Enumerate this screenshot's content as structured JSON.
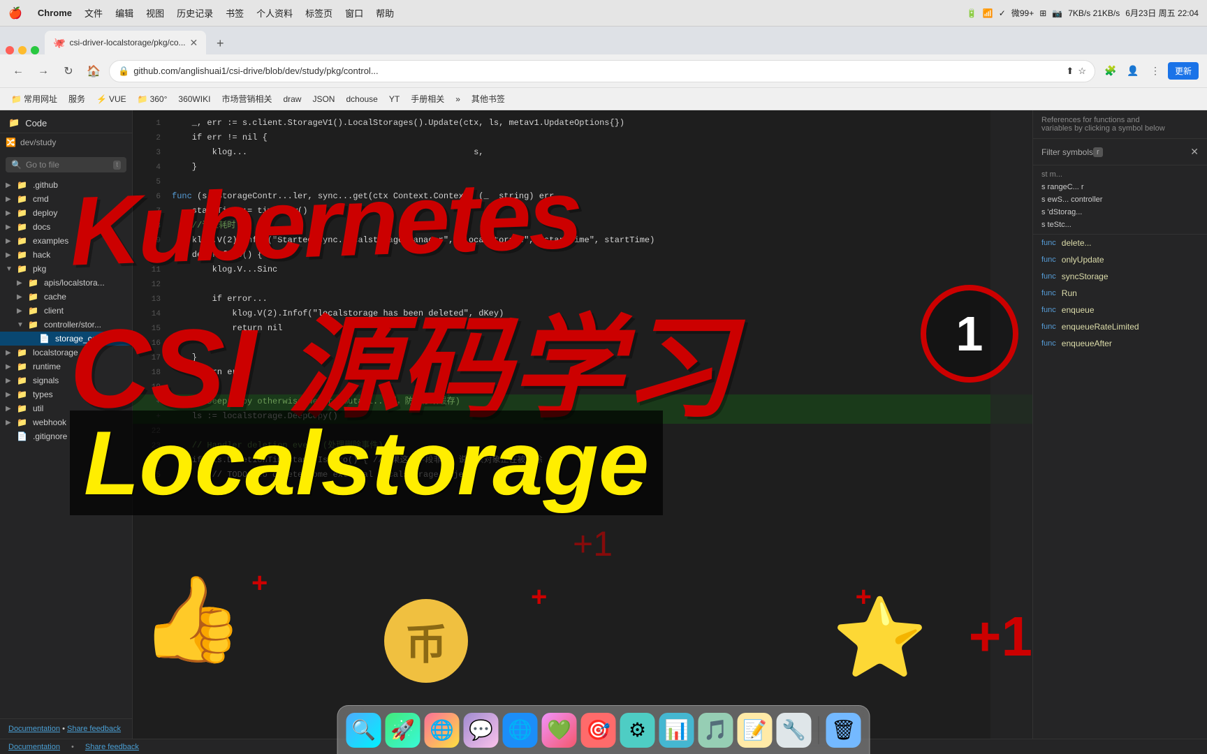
{
  "menubar": {
    "apple": "🍎",
    "items": [
      "Chrome",
      "文件",
      "编辑",
      "视图",
      "历史记录",
      "书签",
      "个人资料",
      "标签页",
      "窗口",
      "帮助"
    ],
    "right_items": [
      "🔋2",
      "🔋",
      "WiFi",
      "✓",
      "WeChat 99+",
      "⚙",
      "📷",
      "7KB/s 21KB/s",
      "☀",
      "6月23日 周五 22:04"
    ]
  },
  "browser": {
    "tab": {
      "favicon": "🐙",
      "title": "csi-driver-localstorage/pkg/co...",
      "url": "github.com/anglishuai1/csi-drive/blob/dev/study/pkg/control..."
    },
    "address_bar": {
      "back": "←",
      "forward": "→",
      "refresh": "↻",
      "url": "github.com/anglishuai1/csi-drive/blob/dev/study/pkg/control..."
    }
  },
  "bookmarks": [
    "常用网址",
    "服务",
    "VUE",
    "360°",
    "360WIKI",
    "市场营销相关",
    "draw",
    "JSON",
    "dchouse",
    "YT",
    "手册相关",
    "其他书签"
  ],
  "sidebar": {
    "header_icon": "📁",
    "header_title": "Code",
    "branch": "dev/study",
    "search_placeholder": "Go to file",
    "search_shortcut": "t",
    "tree": [
      {
        "indent": 0,
        "type": "folder",
        "expanded": false,
        "name": ".github"
      },
      {
        "indent": 0,
        "type": "folder",
        "expanded": false,
        "name": "cmd"
      },
      {
        "indent": 0,
        "type": "folder",
        "expanded": false,
        "name": "deploy"
      },
      {
        "indent": 0,
        "type": "folder",
        "expanded": false,
        "name": "docs"
      },
      {
        "indent": 0,
        "type": "folder",
        "expanded": false,
        "name": "examples"
      },
      {
        "indent": 0,
        "type": "folder",
        "expanded": false,
        "name": "hack"
      },
      {
        "indent": 0,
        "type": "folder",
        "expanded": true,
        "name": "pkg"
      },
      {
        "indent": 1,
        "type": "folder",
        "expanded": false,
        "name": "apis/localstora..."
      },
      {
        "indent": 1,
        "type": "folder",
        "expanded": false,
        "name": "cache"
      },
      {
        "indent": 1,
        "type": "folder",
        "expanded": false,
        "name": "client"
      },
      {
        "indent": 1,
        "type": "folder",
        "expanded": true,
        "name": "controller/stor..."
      },
      {
        "indent": 2,
        "type": "file",
        "active": true,
        "name": "storage_cont..."
      },
      {
        "indent": 0,
        "type": "folder",
        "expanded": false,
        "name": "localstorage"
      },
      {
        "indent": 0,
        "type": "folder",
        "expanded": false,
        "name": "runtime"
      },
      {
        "indent": 0,
        "type": "folder",
        "expanded": false,
        "name": "signals"
      },
      {
        "indent": 0,
        "type": "folder",
        "expanded": false,
        "name": "types"
      },
      {
        "indent": 0,
        "type": "folder",
        "expanded": false,
        "name": "util"
      },
      {
        "indent": 0,
        "type": "folder",
        "expanded": false,
        "name": "webhook"
      },
      {
        "indent": 0,
        "type": "file",
        "expanded": false,
        "name": ".gitignore"
      }
    ],
    "footer_doc": "Documentation",
    "footer_feedback": "Share feedback"
  },
  "code": {
    "lines": [
      {
        "num": "1",
        "text": "func (s *StorageContr...ler, sync...get(ctx Context.Context, (_  string) er"
      },
      {
        "num": "2",
        "text": "    startTime := time.Now()"
      },
      {
        "num": "3",
        "text": "    //记录耗时"
      },
      {
        "num": "4",
        "text": "    klog.V(2).InfoS(\"Started sync...calstorage manager\", \"localstorage\", \"startTime\", startTime)"
      },
      {
        "num": "5",
        "text": "    defer func() {"
      },
      {
        "num": "6",
        "text": "        klog.V...Sinc...er stor"
      },
      {
        "num": "7",
        "text": ""
      },
      {
        "num": "8",
        "text": "        if error..."
      },
      {
        "num": "9",
        "text": "            klog.V(2).Infof(\"localstorage has been deleted\", dKey)"
      },
      {
        "num": "10",
        "text": "            return nil"
      },
      {
        "num": "11",
        "text": "        }"
      },
      {
        "num": "12",
        "text": "    }"
      },
      {
        "num": "13",
        "text": "    return err"
      },
      {
        "num": "14",
        "text": ""
      },
      {
        "num": "15",
        "text": "    // Deep copy otherwise we are mutati...制，防止修改缓存)"
      },
      {
        "num": "16",
        "text": "    ls := localstorage.DeepCopy()"
      },
      {
        "num": "17",
        "text": ""
      },
      {
        "num": "18",
        "text": "    // Handler deletion event (处理删除事件)"
      },
      {
        "num": "19",
        "text": "    if !ls.DeletionTimestamp.IsZero() { //如果这个字段非零，说明该对象正在被删除"
      },
      {
        "num": "20",
        "text": "        // TODO: to delete some external localstorage object"
      }
    ]
  },
  "right_panel": {
    "title": "Filter symbols",
    "shortcut": "r",
    "symbols": [
      {
        "tag": "func",
        "name": "delete..."
      },
      {
        "tag": "func",
        "name": "onlyUpdate"
      },
      {
        "tag": "func",
        "name": "syncStorage"
      },
      {
        "tag": "func",
        "name": "Run"
      },
      {
        "tag": "func",
        "name": "enqueue"
      },
      {
        "tag": "func",
        "name": "enqueueRateLimited"
      },
      {
        "tag": "func",
        "name": "enqueueAfter"
      }
    ],
    "outline_items": [
      "st m...",
      "s rangeC...",
      "s ewS...",
      "s 'dStorag...",
      "s teStc..."
    ]
  },
  "overlay": {
    "kubernetes_text": "Kubernetes",
    "csi_text": "CSI 源码学习",
    "localstorage_text": "Localstorage",
    "thumbs_up": "👍",
    "coin": "币",
    "star": "⭐",
    "plus_one": "+1",
    "circle_num": "1"
  },
  "status_bar": {
    "doc_link": "Documentation",
    "feedback_link": "Share feedback"
  },
  "dock": {
    "icons": [
      "🔍",
      "📁",
      "🌐",
      "💬",
      "📱",
      "🎨",
      "📝",
      "⚙",
      "📊",
      "🎵",
      "📷",
      "🔧"
    ]
  }
}
